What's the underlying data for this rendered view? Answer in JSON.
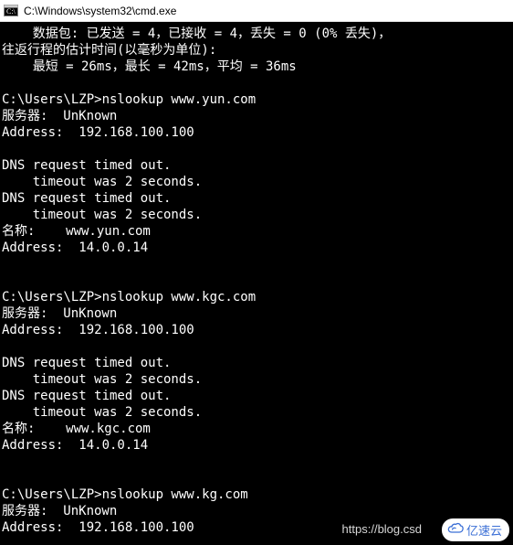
{
  "window": {
    "title": "C:\\Windows\\system32\\cmd.exe"
  },
  "terminal": {
    "lines": [
      "    数据包: 已发送 = 4，已接收 = 4，丢失 = 0 (0% 丢失)，",
      "往返行程的估计时间(以毫秒为单位):",
      "    最短 = 26ms，最长 = 42ms，平均 = 36ms",
      "",
      "C:\\Users\\LZP>nslookup www.yun.com",
      "服务器:  UnKnown",
      "Address:  192.168.100.100",
      "",
      "DNS request timed out.",
      "    timeout was 2 seconds.",
      "DNS request timed out.",
      "    timeout was 2 seconds.",
      "名称:    www.yun.com",
      "Address:  14.0.0.14",
      "",
      "",
      "C:\\Users\\LZP>nslookup www.kgc.com",
      "服务器:  UnKnown",
      "Address:  192.168.100.100",
      "",
      "DNS request timed out.",
      "    timeout was 2 seconds.",
      "DNS request timed out.",
      "    timeout was 2 seconds.",
      "名称:    www.kgc.com",
      "Address:  14.0.0.14",
      "",
      "",
      "C:\\Users\\LZP>nslookup www.kg.com",
      "服务器:  UnKnown",
      "Address:  192.168.100.100"
    ]
  },
  "watermark": {
    "text": "https://blog.csd"
  },
  "brand": {
    "text": "亿速云"
  }
}
